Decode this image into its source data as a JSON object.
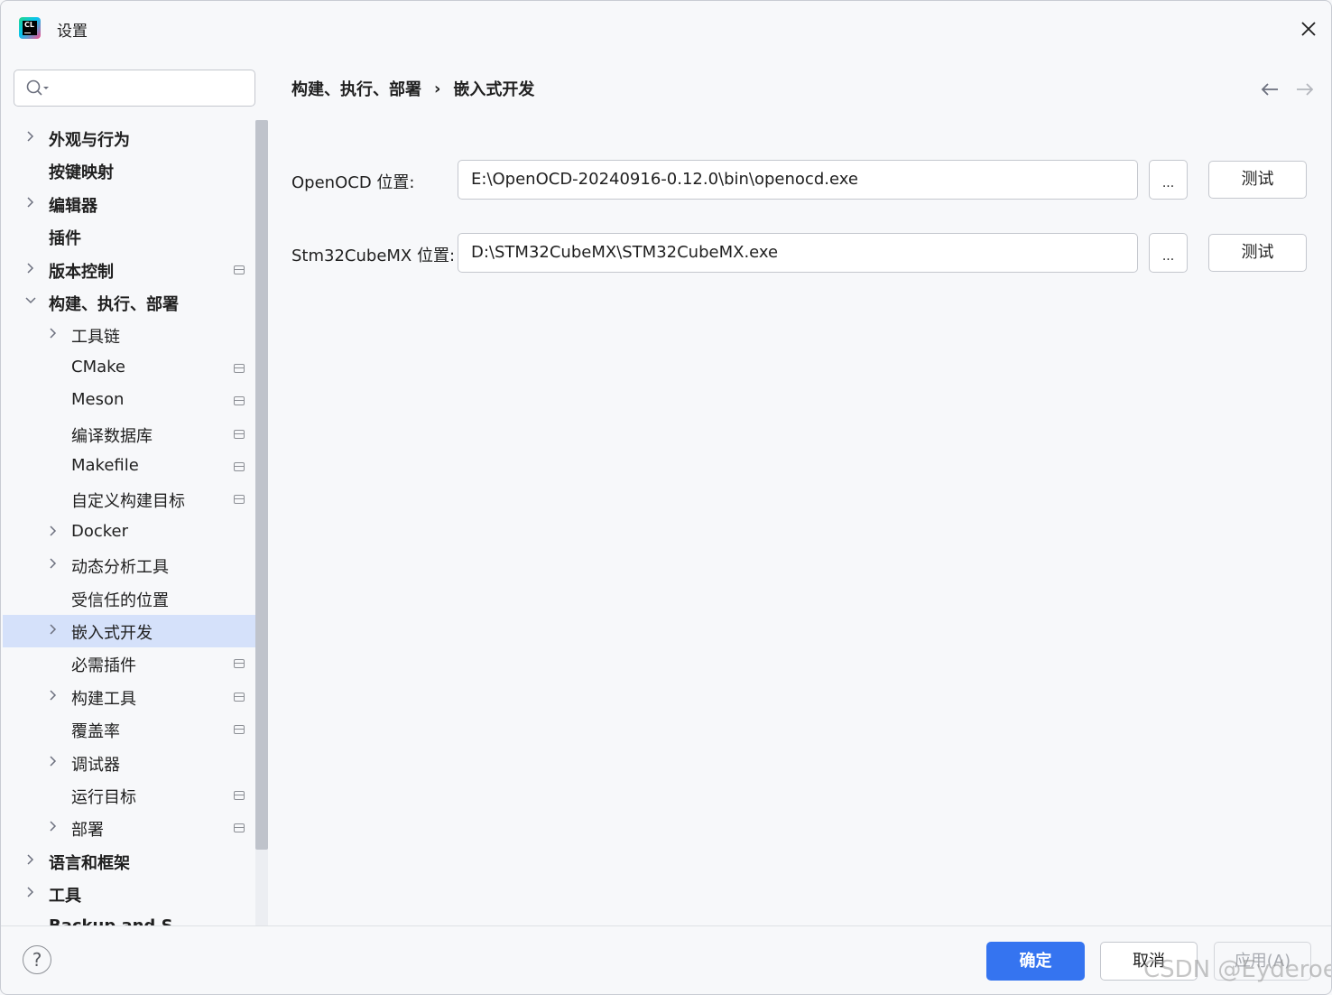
{
  "window": {
    "title": "设置",
    "app_icon": "clion-logo-icon",
    "app_icon_text": "CL"
  },
  "search": {
    "placeholder": "",
    "value": ""
  },
  "tree": [
    {
      "label": "外观与行为",
      "level": 0,
      "expandable": true,
      "expanded": false,
      "project_icon": false
    },
    {
      "label": "按键映射",
      "level": 0,
      "expandable": false,
      "project_icon": false
    },
    {
      "label": "编辑器",
      "level": 0,
      "expandable": true,
      "expanded": false,
      "project_icon": false
    },
    {
      "label": "插件",
      "level": 0,
      "expandable": false,
      "project_icon": false
    },
    {
      "label": "版本控制",
      "level": 0,
      "expandable": true,
      "expanded": false,
      "project_icon": true
    },
    {
      "label": "构建、执行、部署",
      "level": 0,
      "expandable": true,
      "expanded": true,
      "project_icon": false
    },
    {
      "label": "工具链",
      "level": 1,
      "expandable": true,
      "expanded": false,
      "project_icon": false
    },
    {
      "label": "CMake",
      "level": 1,
      "expandable": false,
      "project_icon": true
    },
    {
      "label": "Meson",
      "level": 1,
      "expandable": false,
      "project_icon": true
    },
    {
      "label": "编译数据库",
      "level": 1,
      "expandable": false,
      "project_icon": true
    },
    {
      "label": "Makefile",
      "level": 1,
      "expandable": false,
      "project_icon": true
    },
    {
      "label": "自定义构建目标",
      "level": 1,
      "expandable": false,
      "project_icon": true
    },
    {
      "label": "Docker",
      "level": 1,
      "expandable": true,
      "expanded": false,
      "project_icon": false
    },
    {
      "label": "动态分析工具",
      "level": 1,
      "expandable": true,
      "expanded": false,
      "project_icon": false
    },
    {
      "label": "受信任的位置",
      "level": 1,
      "expandable": false,
      "project_icon": false
    },
    {
      "label": "嵌入式开发",
      "level": 1,
      "expandable": true,
      "expanded": false,
      "project_icon": false,
      "selected": true
    },
    {
      "label": "必需插件",
      "level": 1,
      "expandable": false,
      "project_icon": true
    },
    {
      "label": "构建工具",
      "level": 1,
      "expandable": true,
      "expanded": false,
      "project_icon": true
    },
    {
      "label": "覆盖率",
      "level": 1,
      "expandable": false,
      "project_icon": true
    },
    {
      "label": "调试器",
      "level": 1,
      "expandable": true,
      "expanded": false,
      "project_icon": false
    },
    {
      "label": "运行目标",
      "level": 1,
      "expandable": false,
      "project_icon": true
    },
    {
      "label": "部署",
      "level": 1,
      "expandable": true,
      "expanded": false,
      "project_icon": true
    },
    {
      "label": "语言和框架",
      "level": 0,
      "expandable": true,
      "expanded": false,
      "project_icon": false
    },
    {
      "label": "工具",
      "level": 0,
      "expandable": true,
      "expanded": false,
      "project_icon": false
    },
    {
      "label": "Backup and S",
      "level": 0,
      "expandable": false,
      "project_icon": false
    }
  ],
  "breadcrumb": {
    "parent": "构建、执行、部署",
    "separator": "›",
    "current": "嵌入式开发"
  },
  "settings": {
    "openocd": {
      "label": "OpenOCD 位置:",
      "value": "E:\\OpenOCD-20240916-0.12.0\\bin\\openocd.exe",
      "browse_label": "...",
      "test_label": "测试"
    },
    "cubemx": {
      "label": "Stm32CubeMX 位置:",
      "value": "D:\\STM32CubeMX\\STM32CubeMX.exe",
      "browse_label": "...",
      "test_label": "测试"
    }
  },
  "footer": {
    "help": "?",
    "ok": "确定",
    "cancel": "取消",
    "apply": "应用(A)"
  },
  "watermark": "CSDN @Eyderoe",
  "colors": {
    "accent": "#3574f0",
    "selection": "#d5e1fa",
    "background": "#f7f8fa"
  }
}
